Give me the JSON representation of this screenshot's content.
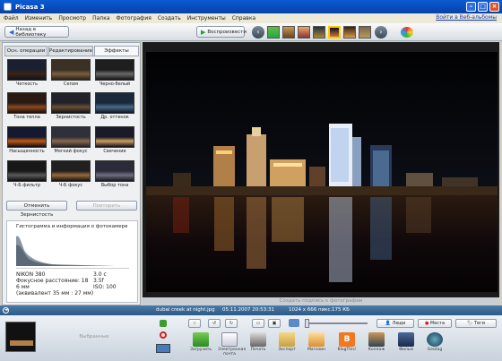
{
  "app": {
    "title": "Picasa 3",
    "sign_in": "Войти в Веб-альбомы"
  },
  "menu": [
    "Файл",
    "Изменить",
    "Просмотр",
    "Папка",
    "Фотография",
    "Создать",
    "Инструменты",
    "Справка"
  ],
  "toolbar": {
    "back_label": "Назад в библиотеку",
    "slideshow_label": "Воспроизвести"
  },
  "tabs": [
    "Осн. операции",
    "Редактирование",
    "Эффекты"
  ],
  "effects": [
    "Четкость",
    "Сепия",
    "Черно-белый",
    "Тона тепла",
    "Зернистость",
    "Др. оттенок",
    "Насыщенность",
    "Мягкий фокус",
    "Свечение",
    "Ч-Б фильтр",
    "Ч-Б фокус",
    "Выбор тона"
  ],
  "panel": {
    "undo_label": "Отменить Зернистость",
    "redo_label": "Повторить"
  },
  "histogram": {
    "title": "Гистограмма и информация о фотокамере",
    "camera": "NIKON 380",
    "focal": "Фокусное расстояние: 18",
    "mm": "6 мм",
    "equiv": "(эквивалент 35 мм : 27 мм)",
    "exposure": "3.0 с",
    "aperture": "3.5f",
    "iso": "ISO: 100"
  },
  "caption_placeholder": "Создать подпись к фотографии",
  "infobar": {
    "filename": "dubai creek at night.jpg",
    "date": "05.11.2007 20:53:31",
    "dims": "1024 x 666 пикс.",
    "size": "175 КБ"
  },
  "tray": {
    "selection_label": "Выбранные",
    "people": "Люди",
    "places": "Места",
    "tags": "Теги"
  },
  "actions": [
    "Загрузить",
    "Электронная почта",
    "Печать",
    "Экспорт",
    "Магазин",
    "BlogThis!",
    "Коллаж",
    "Фильм",
    "Geotag"
  ],
  "colors": {
    "titlebar": "#0a5bd3",
    "infobar": "#3d6b98",
    "accent_green": "#3a9d2e"
  }
}
